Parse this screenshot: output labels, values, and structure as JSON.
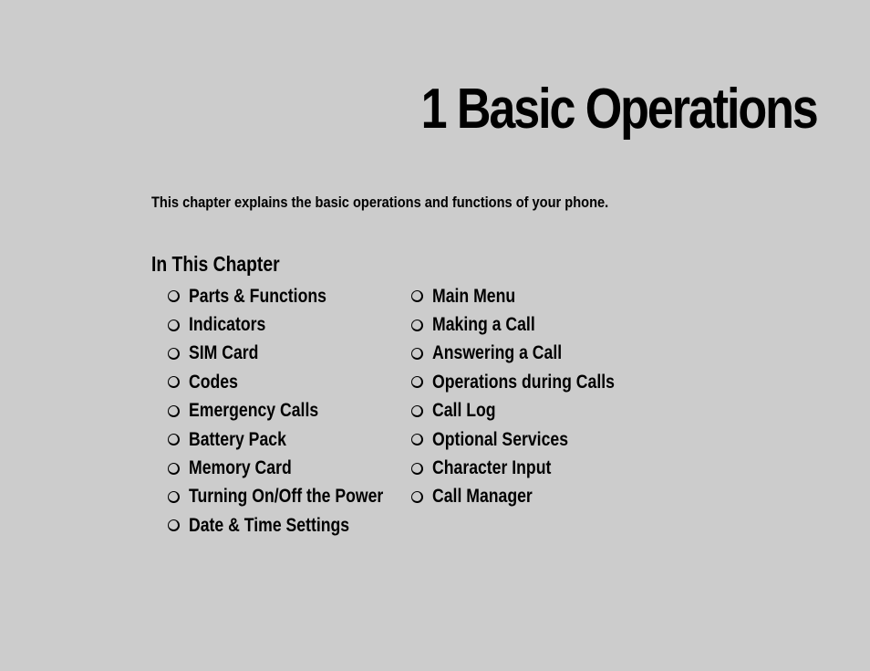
{
  "chapter": {
    "title": "1  Basic Operations",
    "intro": "This chapter explains the basic operations and functions of your phone."
  },
  "in_this_chapter": {
    "heading": "In This Chapter",
    "bullet_icon": "circle-bullet-icon",
    "left_column": [
      "Parts & Functions",
      "Indicators",
      "SIM Card",
      "Codes",
      "Emergency Calls",
      "Battery Pack",
      "Memory Card",
      "Turning On/Off the Power",
      "Date & Time Settings"
    ],
    "right_column": [
      "Main Menu",
      "Making a Call",
      "Answering a Call",
      "Operations during Calls",
      "Call Log",
      "Optional Services",
      "Character Input",
      "Call Manager"
    ]
  }
}
